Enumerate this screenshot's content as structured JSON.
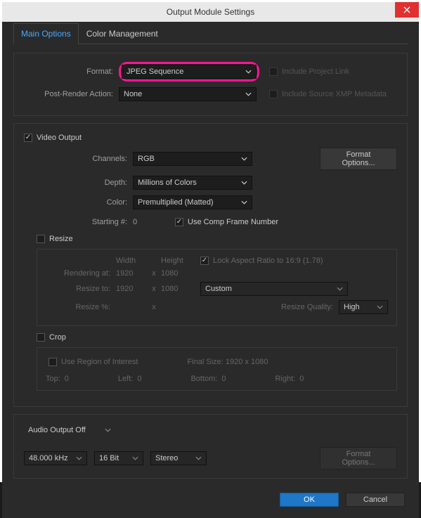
{
  "window": {
    "title": "Output Module Settings"
  },
  "tabs": {
    "main": "Main Options",
    "color": "Color Management"
  },
  "format": {
    "label": "Format:",
    "value": "JPEG Sequence",
    "include_link": "Include Project Link",
    "post_label": "Post-Render Action:",
    "post_value": "None",
    "include_xmp": "Include Source XMP Metadata"
  },
  "video": {
    "section": "Video Output",
    "channels_label": "Channels:",
    "channels_value": "RGB",
    "depth_label": "Depth:",
    "depth_value": "Millions of Colors",
    "color_label": "Color:",
    "color_value": "Premultiplied (Matted)",
    "starting_label": "Starting #:",
    "starting_value": "0",
    "use_comp": "Use Comp Frame Number",
    "format_options": "Format Options..."
  },
  "resize": {
    "section": "Resize",
    "width": "Width",
    "height": "Height",
    "lock": "Lock Aspect Ratio to 16:9 (1.78)",
    "render_label": "Rendering at:",
    "render_w": "1920",
    "render_h": "1080",
    "resize_label": "Resize to:",
    "resize_w": "1920",
    "resize_h": "1080",
    "custom": "Custom",
    "pct_label": "Resize %:",
    "quality_label": "Resize Quality:",
    "quality_value": "High",
    "x": "x"
  },
  "crop": {
    "section": "Crop",
    "roi": "Use Region of Interest",
    "final": "Final Size: 1920 x 1080",
    "top": "Top:",
    "left": "Left:",
    "bottom": "Bottom:",
    "right": "Right:",
    "zero": "0"
  },
  "audio": {
    "section": "Audio Output Off",
    "rate": "48.000 kHz",
    "bits": "16 Bit",
    "chan": "Stereo",
    "format_options": "Format Options..."
  },
  "footer": {
    "ok": "OK",
    "cancel": "Cancel"
  }
}
